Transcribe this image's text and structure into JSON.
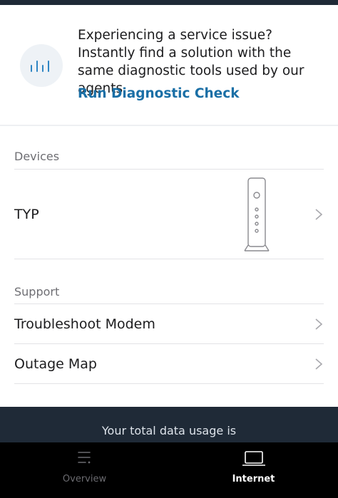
{
  "promo": {
    "message": "Experiencing a service issue? Instantly find a solution with the same diagnostic tools used by our agents.",
    "link_label": "Run Diagnostic Check",
    "icon": "signal-bars-icon"
  },
  "devices": {
    "section_label": "Devices",
    "items": [
      {
        "label": "TYP",
        "icon": "modem-icon"
      }
    ]
  },
  "support": {
    "section_label": "Support",
    "items": [
      {
        "label": "Troubleshoot Modem"
      },
      {
        "label": "Outage Map"
      }
    ]
  },
  "banner": {
    "text": "Your total data usage is"
  },
  "tabs": [
    {
      "label": "Overview",
      "icon": "overview-icon",
      "active": false
    },
    {
      "label": "Internet",
      "icon": "laptop-icon",
      "active": true
    }
  ],
  "colors": {
    "link": "#1a6fa6",
    "dark_bar": "#1f2a37",
    "tab_active": "#ffffff",
    "tab_inactive": "#6b6b70"
  }
}
